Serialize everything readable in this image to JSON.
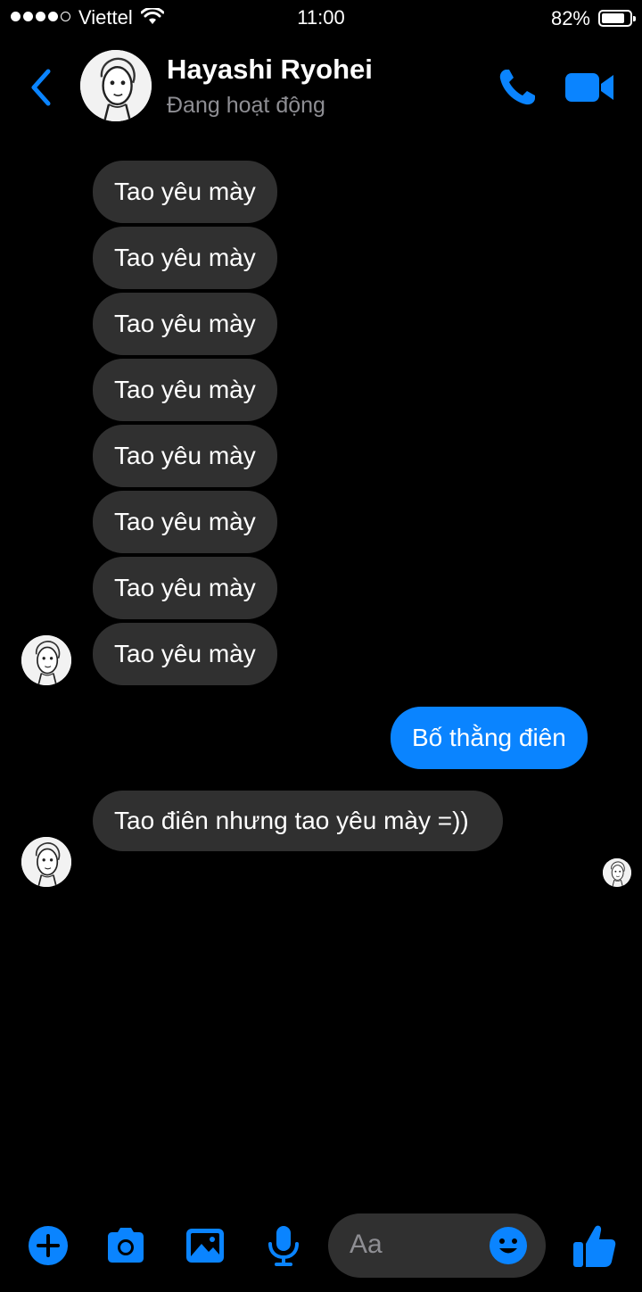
{
  "status_bar": {
    "carrier": "Viettel",
    "time": "11:00",
    "battery_percent": "82%",
    "battery_level": 0.82
  },
  "header": {
    "contact_name": "Hayashi Ryohei",
    "presence": "Đang hoạt động"
  },
  "messages": [
    {
      "direction": "in",
      "text": "Tao yêu mày"
    },
    {
      "direction": "in",
      "text": "Tao yêu mày"
    },
    {
      "direction": "in",
      "text": "Tao yêu mày"
    },
    {
      "direction": "in",
      "text": "Tao yêu mày"
    },
    {
      "direction": "in",
      "text": "Tao yêu mày"
    },
    {
      "direction": "in",
      "text": "Tao yêu mày"
    },
    {
      "direction": "in",
      "text": "Tao yêu mày"
    },
    {
      "direction": "in",
      "text": "Tao yêu mày"
    },
    {
      "direction": "out",
      "text": "Bố thằng điên"
    },
    {
      "direction": "in",
      "text": "Tao điên nhưng tao yêu mày =))"
    }
  ],
  "composer": {
    "placeholder": "Aa"
  },
  "colors": {
    "accent": "#0a84ff",
    "incoming_bubble": "#303030",
    "background": "#000000",
    "secondary_text": "#8e8e93"
  },
  "icons": [
    "back-chevron-icon",
    "phone-icon",
    "video-camera-icon",
    "plus-icon",
    "camera-icon",
    "image-icon",
    "microphone-icon",
    "emoji-icon",
    "thumbs-up-icon"
  ]
}
